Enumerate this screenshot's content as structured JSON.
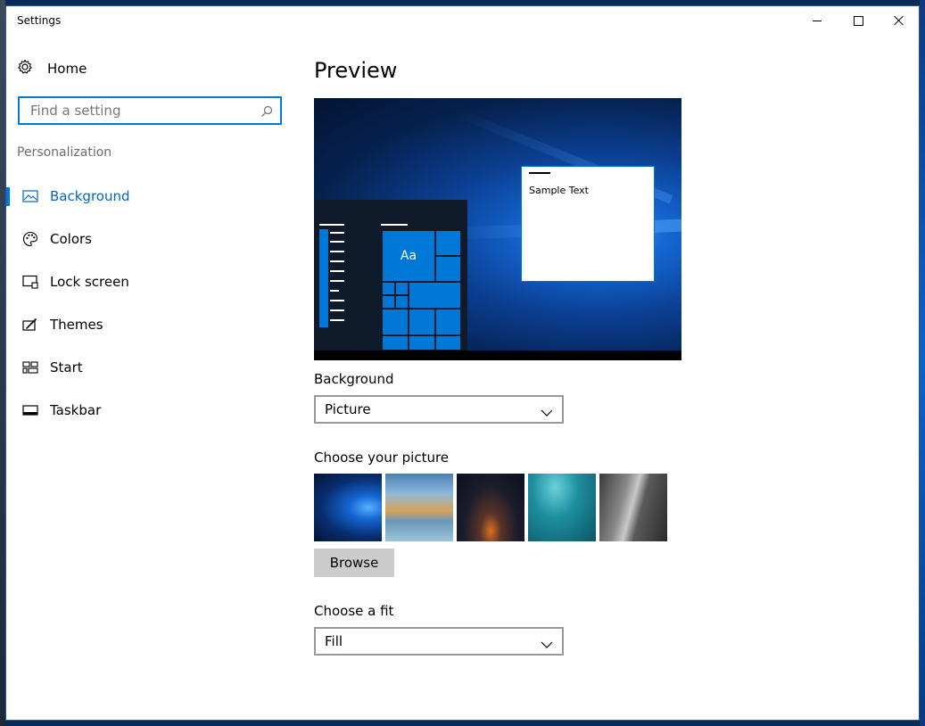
{
  "window": {
    "title": "Settings"
  },
  "sidebar": {
    "home_label": "Home",
    "search_placeholder": "Find a setting",
    "section": "Personalization",
    "items": [
      {
        "label": "Background",
        "icon": "picture-icon",
        "active": true
      },
      {
        "label": "Colors",
        "icon": "palette-icon"
      },
      {
        "label": "Lock screen",
        "icon": "lock-screen-icon"
      },
      {
        "label": "Themes",
        "icon": "themes-icon"
      },
      {
        "label": "Start",
        "icon": "start-icon"
      },
      {
        "label": "Taskbar",
        "icon": "taskbar-icon"
      }
    ]
  },
  "main": {
    "title": "Preview",
    "preview": {
      "tile_text": "Aa",
      "sample_text": "Sample Text"
    },
    "background_label": "Background",
    "background_value": "Picture",
    "choose_picture_label": "Choose your picture",
    "pictures": [
      "windows-hero-blue",
      "beach-rocks",
      "night-sky-tent",
      "underwater-swimmer",
      "rock-climber"
    ],
    "browse_label": "Browse",
    "fit_label": "Choose a fit",
    "fit_value": "Fill"
  },
  "colors": {
    "accent": "#0078d7",
    "active_text": "#0067c0"
  }
}
